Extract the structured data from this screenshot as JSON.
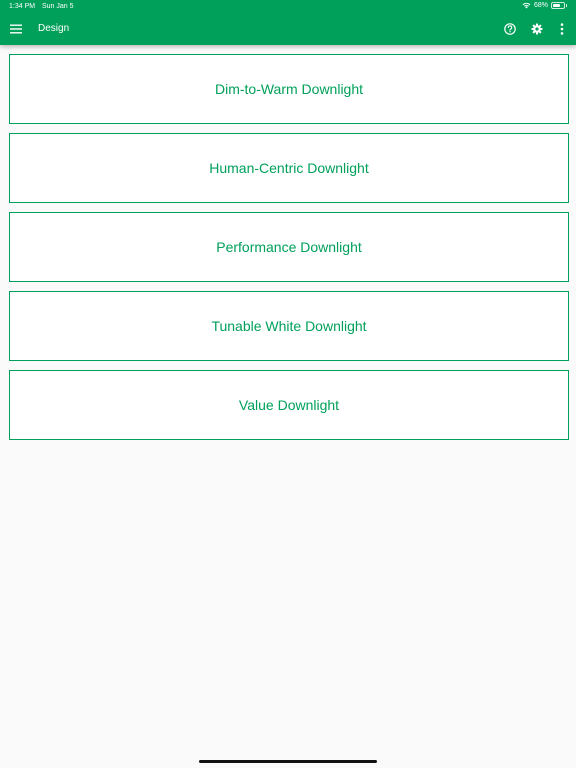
{
  "status_bar": {
    "time": "1:34 PM",
    "date": "Sun Jan 5",
    "battery_percent": "68%",
    "battery_level": 0.68
  },
  "app_bar": {
    "title": "Design",
    "accent_color": "#00a05a",
    "icons": [
      "menu-icon",
      "help-icon",
      "settings-icon",
      "more-vert-icon"
    ]
  },
  "products": [
    {
      "label": "Dim-to-Warm Downlight"
    },
    {
      "label": "Human-Centric Downlight"
    },
    {
      "label": "Performance Downlight"
    },
    {
      "label": "Tunable White Downlight"
    },
    {
      "label": "Value Downlight"
    }
  ]
}
